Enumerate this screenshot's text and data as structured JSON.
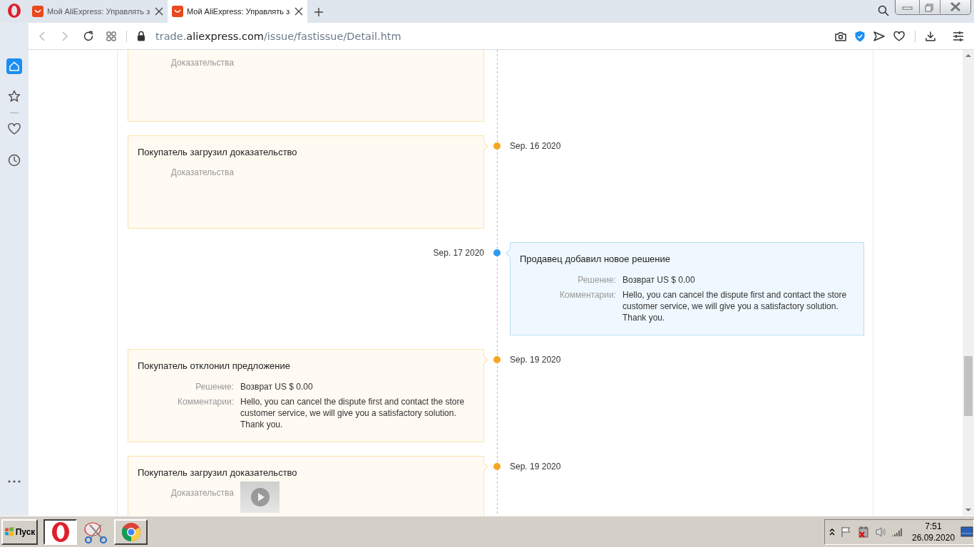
{
  "browser": {
    "tabs": [
      {
        "title": "Мой AliExpress: Управлять з",
        "selected": false
      },
      {
        "title": "Мой AliExpress: Управлять з",
        "selected": true
      }
    ],
    "address": "trade.**aliexpress.com**/issue/fastissue/Detail.htm"
  },
  "timeline": {
    "events": [
      {
        "kind": "buyer",
        "evidence_label": "Доказательства"
      },
      {
        "kind": "buyer",
        "title": "Покупатель загрузил доказательство",
        "date": "Sep. 16 2020",
        "color": "#f5a623",
        "evidence_label": "Доказательства"
      },
      {
        "kind": "seller",
        "title": "Продавец добавил новое решение",
        "date": "Sep. 17 2020",
        "color": "#2d9cf0",
        "details": [
          {
            "label": "Решение:",
            "value": "Возврат US $ 0.00"
          },
          {
            "label": "Комментарии:",
            "value": "Hello, you can cancel the dispute first and contact the store customer service, we will give you a satisfactory solution. Thank you."
          }
        ]
      },
      {
        "kind": "buyer",
        "title": "Покупатель отклонил предложение",
        "date": "Sep. 19 2020",
        "color": "#f5a623",
        "details": [
          {
            "label": "Решение:",
            "value": "Возврат US $ 0.00"
          },
          {
            "label": "Комментарии:",
            "value": "Hello, you can cancel the dispute first and contact the store customer service, we will give you a satisfactory solution. Thank you."
          }
        ]
      },
      {
        "kind": "buyer",
        "title": "Покупатель загрузил доказательство",
        "date": "Sep. 19 2020",
        "color": "#f5a623",
        "evidence_label": "Доказательства",
        "attachments": [
          {
            "kind": "video"
          }
        ]
      }
    ]
  },
  "taskbar": {
    "start_label": "Пуск",
    "apps": [
      {
        "kind": "opera",
        "selected": true
      },
      {
        "kind": "chrome",
        "selected": false
      }
    ],
    "clock": {
      "time": "7:51",
      "date": "26.09.2020"
    }
  }
}
